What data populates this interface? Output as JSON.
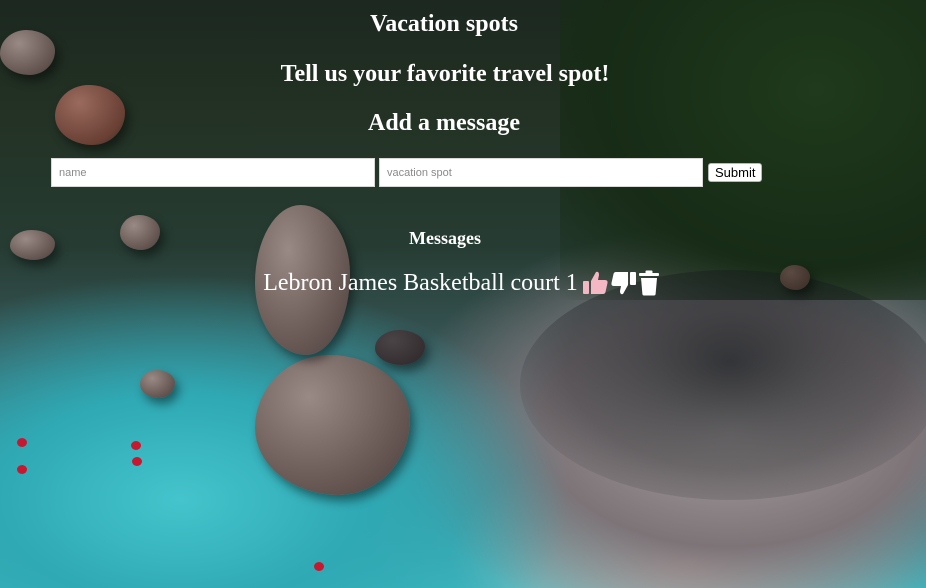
{
  "header": {
    "title": "Vacation spots",
    "prompt": "Tell us your favorite travel spot!"
  },
  "form": {
    "title": "Add a message",
    "name_placeholder": "name",
    "spot_placeholder": "vacation spot",
    "submit_label": "Submit"
  },
  "messages": {
    "title": "Messages",
    "items": [
      {
        "name": "Lebron James",
        "spot": "Basketball court",
        "count": "1",
        "actions": {
          "thumbs_up_icon": "thumbs-up-icon",
          "thumbs_down_icon": "thumbs-down-icon",
          "trash_icon": "trash-icon"
        }
      }
    ]
  },
  "colors": {
    "text": "#ffffff",
    "thumbs_up": "#f4b8c4",
    "thumbs_down": "#ffffff",
    "trash": "#ffffff"
  }
}
